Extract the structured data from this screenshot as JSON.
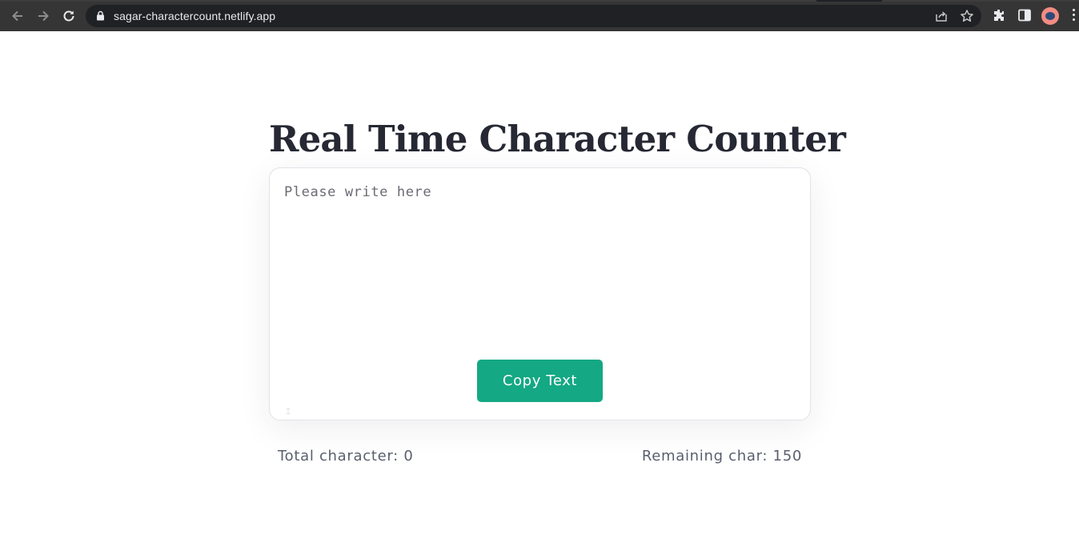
{
  "browser": {
    "url": "sagar-charactercount.netlify.app",
    "icons": [
      "back-icon",
      "forward-icon",
      "reload-icon",
      "lock-icon",
      "share-icon",
      "star-icon",
      "extensions-icon",
      "sidepanel-icon",
      "profile-avatar",
      "menu-icon"
    ]
  },
  "page": {
    "title": "Real Time Character Counter",
    "textarea_placeholder": "Please write here",
    "copy_button_label": "Copy Text",
    "total_label": "Total character: 0",
    "remaining_label": "Remaining char: 150"
  },
  "colors": {
    "button": "#14a884",
    "title": "#262833",
    "stats": "#5a5f6e"
  }
}
